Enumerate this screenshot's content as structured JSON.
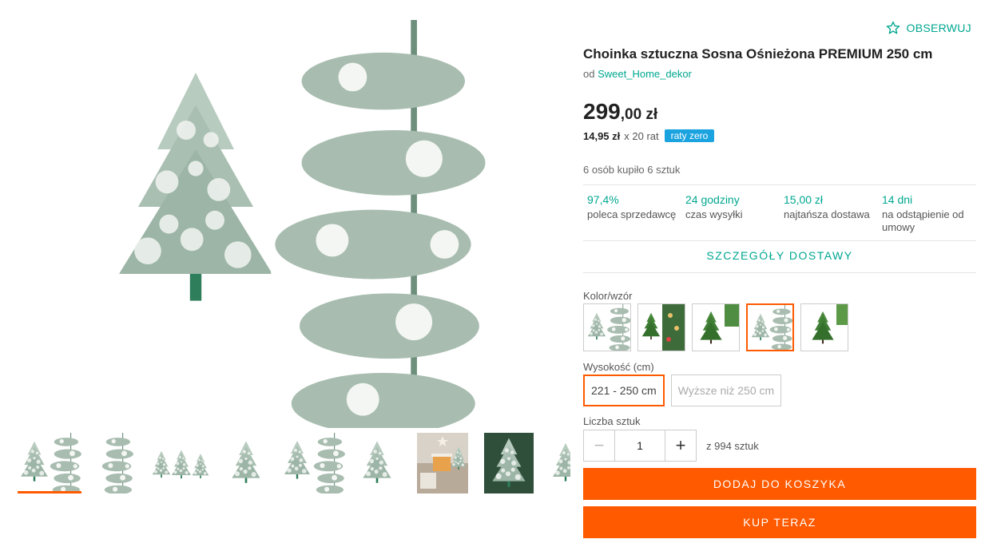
{
  "watch": {
    "label": "OBSERWUJ",
    "icon": "star-outline-icon"
  },
  "product": {
    "title": "Choinka sztuczna Sosna Ośnieżona PREMIUM 250 cm",
    "seller_prefix": "od",
    "seller_name": "Sweet_Home_dekor"
  },
  "price": {
    "whole": "299",
    "fraction": ",00 zł",
    "installment_amount": "14,95 zł",
    "installment_rest": "x 20 rat",
    "installment_badge": "raty zero"
  },
  "bought": "6 osób kupiło 6 sztuk",
  "stats": [
    {
      "value": "97,4%",
      "label": "poleca sprzedawcę"
    },
    {
      "value": "24 godziny",
      "label": "czas wysyłki"
    },
    {
      "value": "15,00 zł",
      "label": "najtańsza dostawa"
    },
    {
      "value": "14 dni",
      "label": "na odstąpienie od umowy"
    }
  ],
  "delivery_link": "SZCZEGÓŁY DOSTAWY",
  "color": {
    "label": "Kolor/wzór",
    "selected_index": 3
  },
  "height": {
    "label": "Wysokość (cm)",
    "options": [
      "221 - 250 cm",
      "Wyższe niż 250 cm"
    ],
    "selected_index": 0
  },
  "quantity": {
    "label": "Liczba sztuk",
    "value": "1",
    "available": "z 994 sztuk"
  },
  "buttons": {
    "add_to_cart": "DODAJ DO KOSZYKA",
    "buy_now": "KUP TERAZ"
  },
  "colors": {
    "accent": "#ff5a00",
    "teal": "#00a790",
    "badge": "#1ba3e0"
  },
  "gallery": {
    "active_index": 0
  }
}
